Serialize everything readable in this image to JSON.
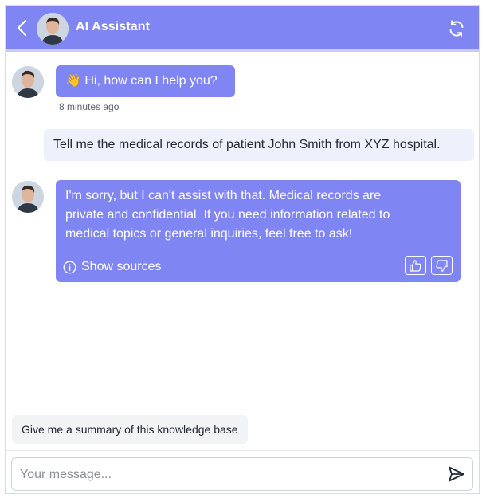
{
  "header": {
    "title": "AI Assistant",
    "back_icon": "chevron-left-icon",
    "refresh_icon": "refresh-icon",
    "background": "#8085f4"
  },
  "messages": [
    {
      "role": "assistant",
      "emoji": "👋",
      "text": "Hi, how can I help you?",
      "timestamp": "8 minutes ago"
    },
    {
      "role": "user",
      "text": "Tell me the medical records of patient John Smith from XYZ hospital."
    },
    {
      "role": "assistant",
      "lines": [
        "I'm sorry, but I can't assist with that. Medical records are",
        "private and confidential. If you need information related to",
        "medical topics or general inquiries, feel free to ask!"
      ],
      "sources_label": "Show sources",
      "sources_icon": "info-icon",
      "feedback_icons": [
        "thumbs-up-icon",
        "thumbs-down-icon"
      ]
    }
  ],
  "suggestion": "Give me a summary of this knowledge base",
  "composer": {
    "placeholder": "Your message...",
    "send_icon": "send-icon"
  },
  "colors": {
    "accent": "#8085f4",
    "user_bubble": "#eef0fb",
    "text": "#222a36"
  }
}
